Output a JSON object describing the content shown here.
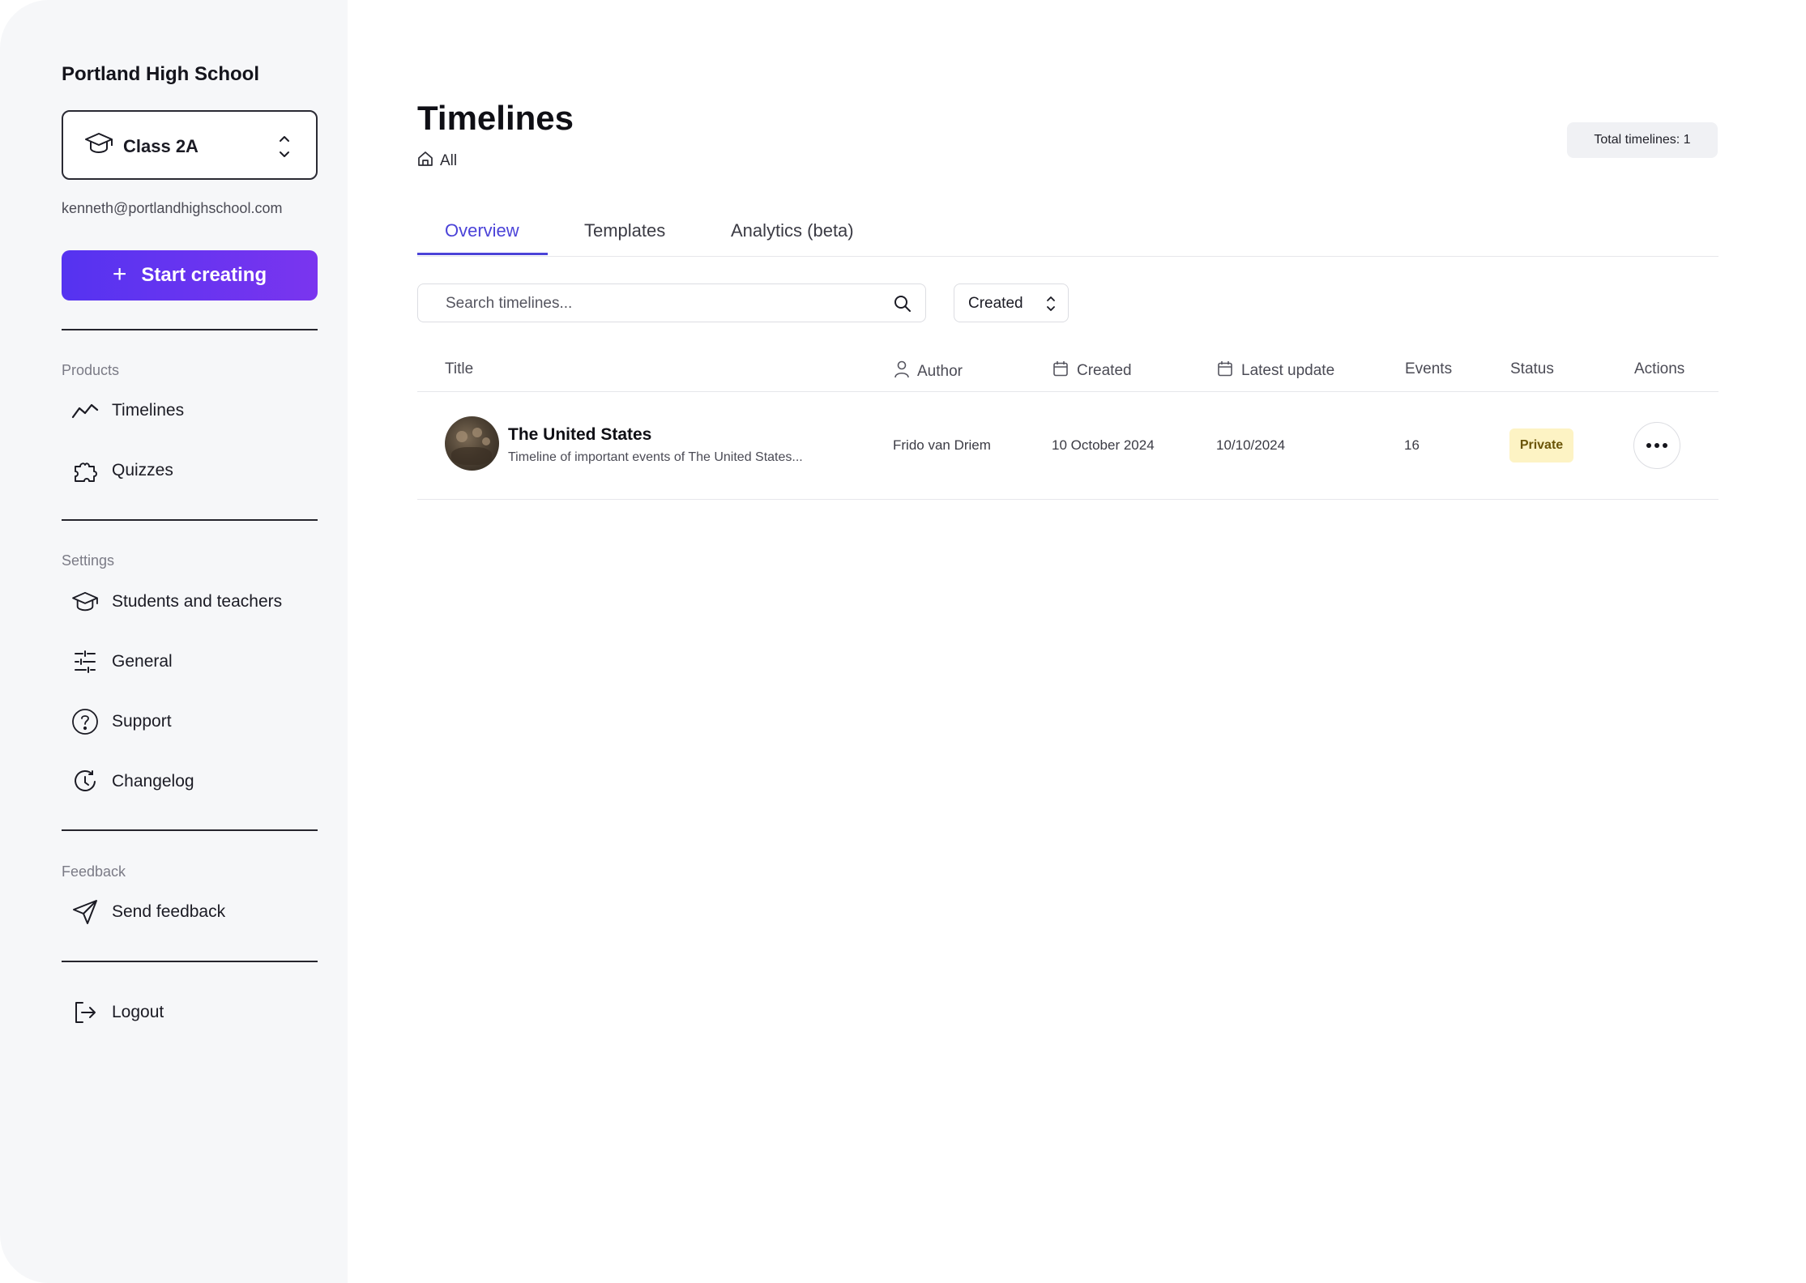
{
  "sidebar": {
    "school_name": "Portland High School",
    "class_select": {
      "value": "Class 2A",
      "icon": "graduation-cap-icon"
    },
    "email": "kenneth@portlandhighschool.com",
    "start_button": {
      "label": "Start creating",
      "icon": "plus-icon"
    },
    "sections": {
      "products": {
        "label": "Products",
        "items": [
          {
            "label": "Timelines",
            "icon": "trend-line-icon"
          },
          {
            "label": "Quizzes",
            "icon": "puzzle-icon"
          }
        ]
      },
      "settings": {
        "label": "Settings",
        "items": [
          {
            "label": "Students and teachers",
            "icon": "graduation-cap-icon"
          },
          {
            "label": "General",
            "icon": "sliders-icon"
          },
          {
            "label": "Support",
            "icon": "help-circle-icon"
          },
          {
            "label": "Changelog",
            "icon": "history-icon"
          }
        ]
      },
      "feedback": {
        "label": "Feedback",
        "items": [
          {
            "label": "Send feedback",
            "icon": "send-icon"
          }
        ]
      }
    },
    "logout": {
      "label": "Logout",
      "icon": "logout-icon"
    }
  },
  "main": {
    "title": "Timelines",
    "breadcrumb": {
      "label": "All",
      "icon": "home-icon"
    },
    "total_badge": "Total timelines: 1",
    "tabs": [
      {
        "label": "Overview",
        "active": true
      },
      {
        "label": "Templates",
        "active": false
      },
      {
        "label": "Analytics (beta)",
        "active": false
      }
    ],
    "search": {
      "placeholder": "Search timelines..."
    },
    "sort": {
      "value": "Created"
    },
    "table": {
      "columns": [
        "Title",
        "Author",
        "Created",
        "Latest update",
        "Events",
        "Status",
        "Actions"
      ],
      "rows": [
        {
          "title": "The United States",
          "subtitle": "Timeline of important events of The United States...",
          "author": "Frido van Driem",
          "created": "10 October 2024",
          "latest_update": "10/10/2024",
          "events": "16",
          "status": "Private"
        }
      ]
    }
  },
  "colors": {
    "accent": "#4b43d8",
    "button_gradient_start": "#5533f0",
    "button_gradient_end": "#7a35ef",
    "sidebar_bg": "#f6f7f9",
    "status_private_bg": "#fdf3c4"
  }
}
